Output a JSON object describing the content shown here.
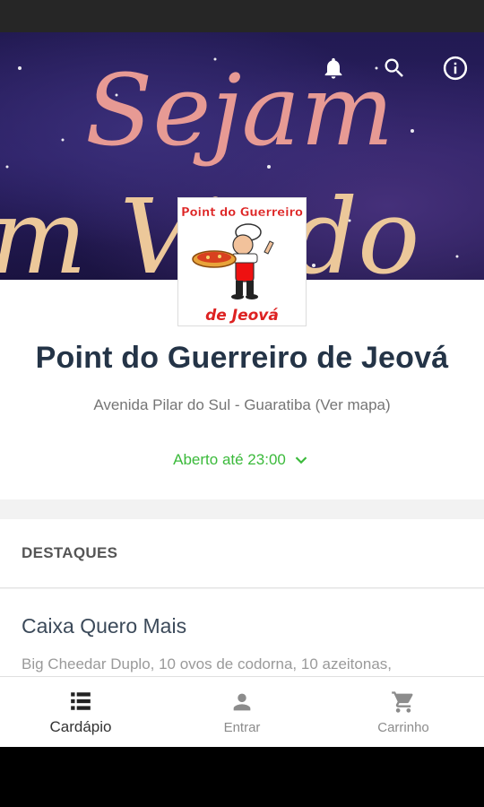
{
  "banner": {
    "text_line1": "Sejam",
    "text_line2": "m Vindo"
  },
  "logo": {
    "line1": "Point do Guerreiro",
    "line2": "de Jeová"
  },
  "store": {
    "name": "Point do Guerreiro de Jeová",
    "address": "Avenida Pilar do Sul - Guaratiba (Ver mapa)",
    "open_status": "Aberto até 23:00"
  },
  "highlights": {
    "title": "DESTAQUES",
    "items": [
      {
        "name": "Caixa Quero Mais",
        "description": "Big Cheedar Duplo, 10 ovos de codorna, 10 azeitonas,"
      }
    ]
  },
  "bottom_nav": {
    "items": [
      {
        "label": "Cardápio",
        "icon": "list-icon"
      },
      {
        "label": "Entrar",
        "icon": "person-icon"
      },
      {
        "label": "Carrinho",
        "icon": "cart-icon"
      }
    ]
  },
  "colors": {
    "accent_green": "#3bba3b",
    "title": "#243447"
  }
}
